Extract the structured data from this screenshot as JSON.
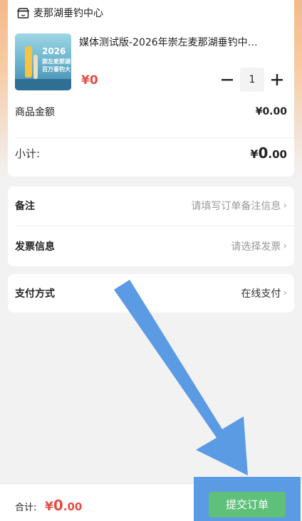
{
  "store": {
    "name": "麦那湖垂钓中心",
    "icon": "store-icon"
  },
  "product": {
    "title": "媒体测试版-2026年崇左麦那湖垂钓中…",
    "price": "¥0",
    "quantity": "1",
    "thumb_year": "2026",
    "thumb_line1": "崇左麦那湖",
    "thumb_line2": "百万垂钓大"
  },
  "amount": {
    "label": "商品金额",
    "value": "¥0.00"
  },
  "subtotal": {
    "label": "小计:",
    "symbol": "¥",
    "integer": "0",
    "decimal": ".00"
  },
  "remarks": {
    "label": "备注",
    "placeholder": "请填写订单备注信息"
  },
  "invoice": {
    "label": "发票信息",
    "placeholder": "请选择发票"
  },
  "payment": {
    "label": "支付方式",
    "value": "在线支付"
  },
  "footer": {
    "total_label": "合计:",
    "total_symbol": "¥",
    "total_integer": "0",
    "total_decimal": ".00",
    "submit_label": "提交订单"
  },
  "colors": {
    "price_red": "#e54d42",
    "submit_green": "#5fc07a",
    "annotation_blue": "#5b9be4",
    "header_orange": "#f5b98a"
  }
}
